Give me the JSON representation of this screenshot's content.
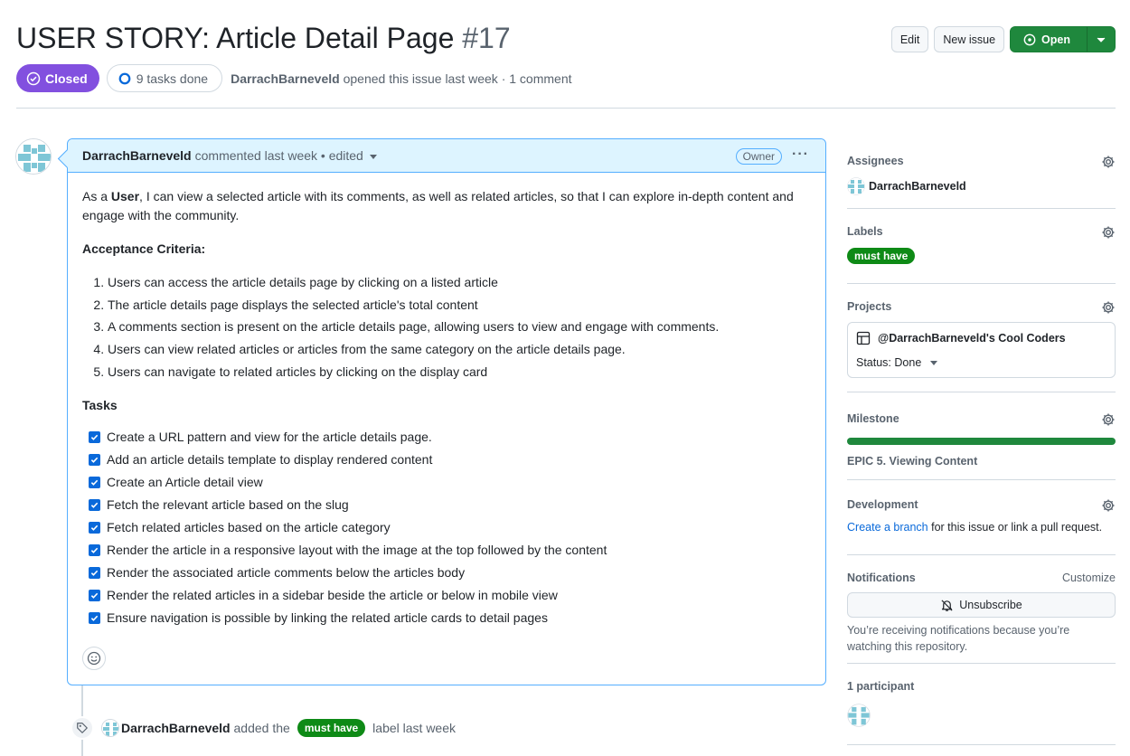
{
  "issue": {
    "title": "USER STORY: Article Detail Page",
    "number": "#17",
    "state": "Closed",
    "tasks_done": "9 tasks done",
    "author": "DarrachBarneveld",
    "opened_text": "opened this issue last week · 1 comment"
  },
  "header_buttons": {
    "edit": "Edit",
    "new_issue": "New issue",
    "open": "Open"
  },
  "comment": {
    "author": "DarrachBarneveld",
    "meta": "commented last week • edited",
    "role": "Owner",
    "intro_pre": "As a ",
    "intro_bold": "User",
    "intro_post": ", I can view a selected article with its comments, as well as related articles, so that I can explore in-depth content and engage with the community.",
    "criteria_heading": "Acceptance Criteria:",
    "criteria": [
      "Users can access the article details page by clicking on a listed article",
      "The article details page displays the selected article's total content",
      "A comments section is present on the article details page, allowing users to view and engage with comments.",
      "Users can view related articles or articles from the same category on the article details page.",
      "Users can navigate to related articles by clicking on the display card"
    ],
    "tasks_heading": "Tasks",
    "tasks": [
      "Create a URL pattern and view for the article details page.",
      "Add an article details template to display rendered content",
      "Create an Article detail view",
      "Fetch the relevant article based on the slug",
      "Fetch related articles based on the article category",
      "Render the article in a responsive layout with the image at the top followed by the content",
      "Render the associated article comments below the articles body",
      "Render the related articles in a sidebar beside the article or below in mobile view",
      "Ensure navigation is possible by linking the related article cards to detail pages"
    ]
  },
  "timeline": {
    "actor": "DarrachBarneveld",
    "action": "added the",
    "label": "must have",
    "suffix": "label last week"
  },
  "sidebar": {
    "assignees": {
      "title": "Assignees",
      "user": "DarrachBarneveld"
    },
    "labels": {
      "title": "Labels",
      "label": "must have"
    },
    "projects": {
      "title": "Projects",
      "name": "@DarrachBarneveld's Cool Coders",
      "status": "Status: Done"
    },
    "milestone": {
      "title": "Milestone",
      "name": "EPIC 5. Viewing Content",
      "progress": 1.0
    },
    "development": {
      "title": "Development",
      "link": "Create a branch",
      "text": " for this issue or link a pull request."
    },
    "notifications": {
      "title": "Notifications",
      "customize": "Customize",
      "button": "Unsubscribe",
      "text": "You’re receiving notifications because you’re watching this repository."
    },
    "participants": {
      "title": "1 participant"
    }
  },
  "colors": {
    "closed_purple": "#8250df",
    "label_green": "#0e8a16",
    "open_green": "#1f883d",
    "link_blue": "#0969da"
  }
}
